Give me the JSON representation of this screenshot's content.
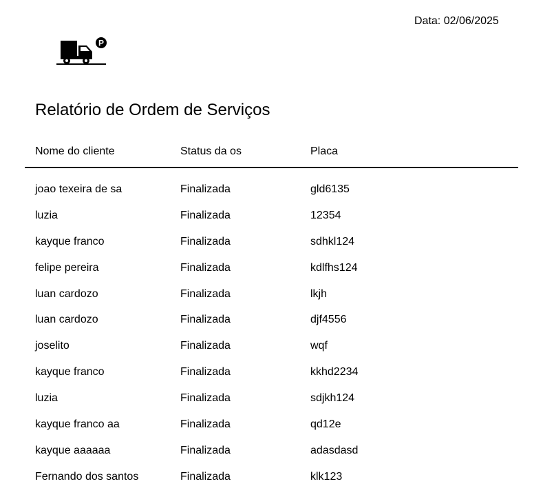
{
  "header": {
    "date_label": "Data:",
    "date_value": "02/06/2025"
  },
  "logo": {
    "icon": "delivery-truck-parking-icon",
    "badge_letter": "P"
  },
  "title": "Relatório de Ordem de Serviços",
  "table": {
    "columns": [
      "Nome do cliente",
      "Status da os",
      "Placa"
    ],
    "rows": [
      {
        "cliente": "joao texeira de sa",
        "status": "Finalizada",
        "placa": "gld6135"
      },
      {
        "cliente": "luzia",
        "status": "Finalizada",
        "placa": "12354"
      },
      {
        "cliente": "kayque franco",
        "status": "Finalizada",
        "placa": "sdhkl124"
      },
      {
        "cliente": "felipe pereira",
        "status": "Finalizada",
        "placa": "kdlfhs124"
      },
      {
        "cliente": "luan cardozo",
        "status": "Finalizada",
        "placa": "lkjh"
      },
      {
        "cliente": "luan cardozo",
        "status": "Finalizada",
        "placa": "djf4556"
      },
      {
        "cliente": "joselito",
        "status": "Finalizada",
        "placa": "wqf"
      },
      {
        "cliente": "kayque franco",
        "status": "Finalizada",
        "placa": "kkhd2234"
      },
      {
        "cliente": "luzia",
        "status": "Finalizada",
        "placa": "sdjkh124"
      },
      {
        "cliente": "kayque franco aa",
        "status": "Finalizada",
        "placa": "qd12e"
      },
      {
        "cliente": "kayque aaaaaa",
        "status": "Finalizada",
        "placa": "adasdasd"
      },
      {
        "cliente": "Fernando dos santos",
        "status": "Finalizada",
        "placa": "klk123"
      }
    ]
  }
}
